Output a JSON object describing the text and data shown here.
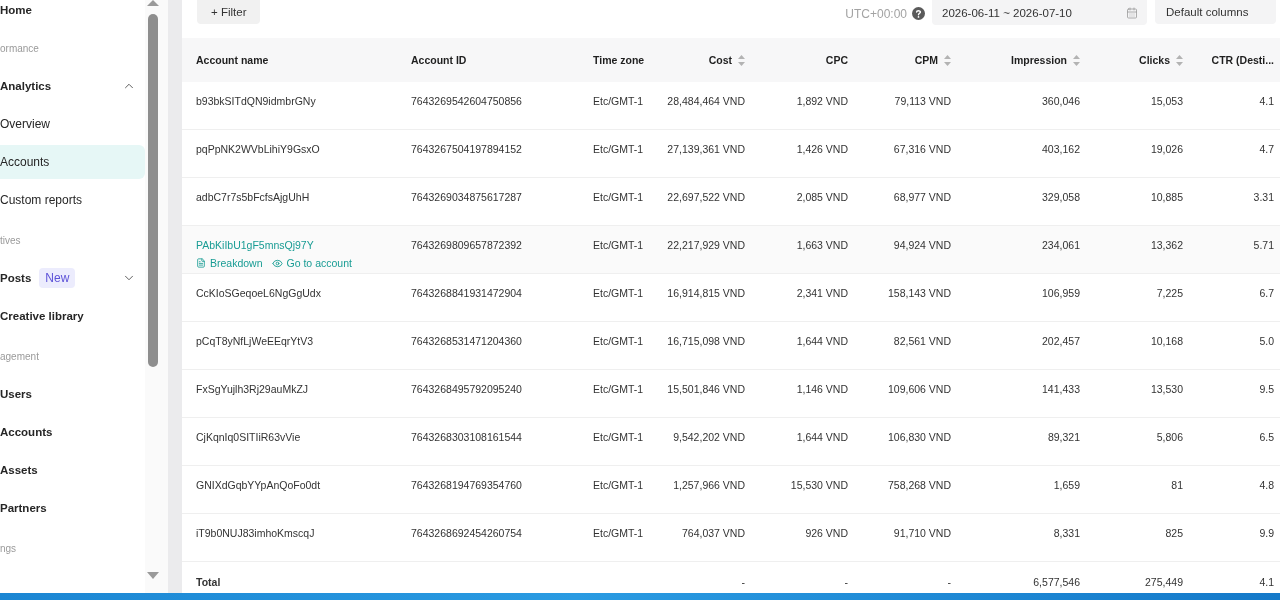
{
  "sidebar": {
    "items": [
      {
        "kind": "link",
        "label": "Home",
        "selected": false
      },
      {
        "kind": "section",
        "label": "ormance"
      },
      {
        "kind": "group",
        "label": "Analytics",
        "expanded": true,
        "children": [
          {
            "label": "Overview",
            "selected": false
          },
          {
            "label": "Accounts",
            "selected": true
          },
          {
            "label": "Custom reports",
            "selected": false
          }
        ]
      },
      {
        "kind": "section",
        "label": "tives"
      },
      {
        "kind": "group",
        "label": "Posts",
        "badge": "New",
        "expanded": false
      },
      {
        "kind": "link",
        "label": "Creative library",
        "selected": false
      },
      {
        "kind": "section",
        "label": "agement"
      },
      {
        "kind": "link",
        "label": "Users",
        "selected": false
      },
      {
        "kind": "link",
        "label": "Accounts",
        "selected": false
      },
      {
        "kind": "link",
        "label": "Assets",
        "selected": false
      },
      {
        "kind": "link",
        "label": "Partners",
        "selected": false
      },
      {
        "kind": "section",
        "label": "ngs"
      }
    ]
  },
  "toolbar": {
    "filter_button": "+ Filter",
    "timezone": "UTC+00:00",
    "date_range": "2026-06-11 ~ 2026-07-10",
    "columns_select": "Default columns"
  },
  "table": {
    "columns": [
      {
        "label": "Account name",
        "kind": "text",
        "sortable": false
      },
      {
        "label": "Account ID",
        "kind": "text",
        "sortable": false
      },
      {
        "label": "Time zone",
        "kind": "text",
        "sortable": false
      },
      {
        "label": "Cost",
        "kind": "number",
        "sortable": true
      },
      {
        "label": "CPC",
        "kind": "number",
        "sortable": false
      },
      {
        "label": "CPM",
        "kind": "number",
        "sortable": true
      },
      {
        "label": "Impression",
        "kind": "number",
        "sortable": true
      },
      {
        "label": "Clicks",
        "kind": "number",
        "sortable": true
      },
      {
        "label": "CTR (Desti...",
        "kind": "number",
        "sortable": false
      }
    ],
    "rows": [
      {
        "hovered": false,
        "cells": [
          "b93bkSITdQN9idmbrGNy",
          "7643269542604750856",
          "Etc/GMT-1",
          "28,484,464 VND",
          "1,892 VND",
          "79,113 VND",
          "360,046",
          "15,053",
          "4.1"
        ]
      },
      {
        "hovered": false,
        "cells": [
          "pqPpNK2WVbLihiY9GsxO",
          "7643267504197894152",
          "Etc/GMT-1",
          "27,139,361 VND",
          "1,426 VND",
          "67,316 VND",
          "403,162",
          "19,026",
          "4.7"
        ]
      },
      {
        "hovered": false,
        "cells": [
          "adbC7r7s5bFcfsAjgUhH",
          "7643269034875617287",
          "Etc/GMT-1",
          "22,697,522 VND",
          "2,085 VND",
          "68,977 VND",
          "329,058",
          "10,885",
          "3.31"
        ]
      },
      {
        "hovered": true,
        "cells": [
          "PAbKiIbU1gF5mnsQj97Y",
          "7643269809657872392",
          "Etc/GMT-1",
          "22,217,929 VND",
          "1,663 VND",
          "94,924 VND",
          "234,061",
          "13,362",
          "5.71"
        ],
        "actions": [
          {
            "kind": "breakdown",
            "label": "Breakdown"
          },
          {
            "kind": "view",
            "label": "Go to account"
          }
        ]
      },
      {
        "hovered": false,
        "cells": [
          "CcKIoSGeqoeL6NgGgUdx",
          "7643268841931472904",
          "Etc/GMT-1",
          "16,914,815 VND",
          "2,341 VND",
          "158,143 VND",
          "106,959",
          "7,225",
          "6.7"
        ]
      },
      {
        "hovered": false,
        "cells": [
          "pCqT8yNfLjWeEEqrYtV3",
          "7643268531471204360",
          "Etc/GMT-1",
          "16,715,098 VND",
          "1,644 VND",
          "82,561 VND",
          "202,457",
          "10,168",
          "5.0"
        ]
      },
      {
        "hovered": false,
        "cells": [
          "FxSgYujlh3Rj29auMkZJ",
          "7643268495792095240",
          "Etc/GMT-1",
          "15,501,846 VND",
          "1,146 VND",
          "109,606 VND",
          "141,433",
          "13,530",
          "9.5"
        ]
      },
      {
        "hovered": false,
        "cells": [
          "CjKqnIq0SITIiR63vVie",
          "7643268303108161544",
          "Etc/GMT-1",
          "9,542,202 VND",
          "1,644 VND",
          "106,830 VND",
          "89,321",
          "5,806",
          "6.5"
        ]
      },
      {
        "hovered": false,
        "cells": [
          "GNIXdGqbYYpAnQoFo0dt",
          "7643268194769354760",
          "Etc/GMT-1",
          "1,257,966 VND",
          "15,530 VND",
          "758,268 VND",
          "1,659",
          "81",
          "4.8"
        ]
      },
      {
        "hovered": false,
        "cells": [
          "iT9b0NUJ83imhoKmscqJ",
          "7643268692454260754",
          "Etc/GMT-1",
          "764,037 VND",
          "926 VND",
          "91,710 VND",
          "8,331",
          "825",
          "9.9"
        ]
      }
    ],
    "total": {
      "label": "Total",
      "values": [
        "-",
        "-",
        "-",
        "6,577,546",
        "275,449",
        "4.1"
      ]
    }
  }
}
